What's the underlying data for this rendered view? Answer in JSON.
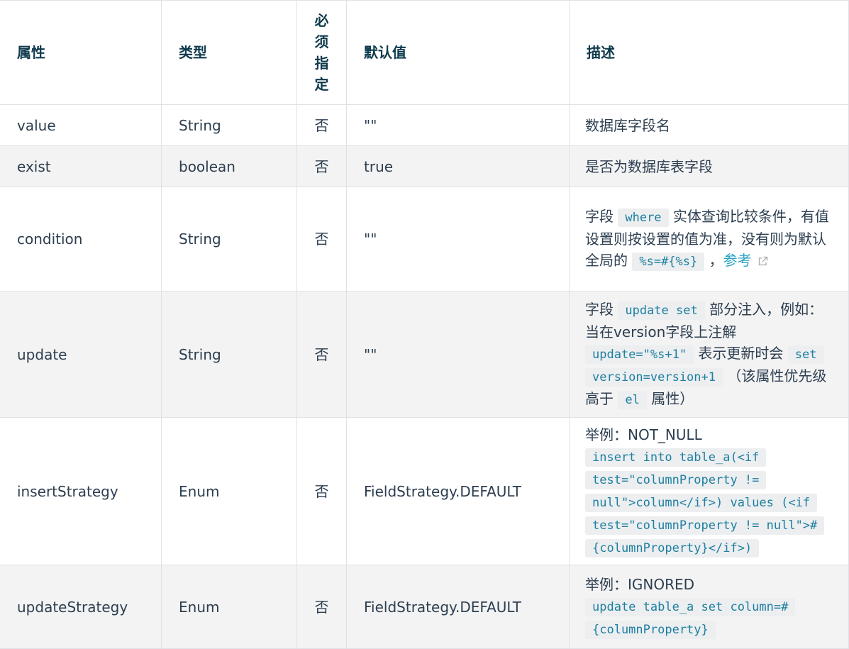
{
  "headers": {
    "attr": "属性",
    "type": "类型",
    "required": "必须指定",
    "default": "默认值",
    "desc": "描述"
  },
  "rows": [
    {
      "attr": "value",
      "type": "String",
      "required": "否",
      "default": "\"\"",
      "desc": "数据库字段名"
    },
    {
      "attr": "exist",
      "type": "boolean",
      "required": "否",
      "default": "true",
      "desc": "是否为数据库表字段"
    },
    {
      "attr": "condition",
      "type": "String",
      "required": "否",
      "default": "\"\"",
      "desc": {
        "t1": "字段 ",
        "c1": "where",
        "t2": " 实体查询比较条件，有值设置则按设置的值为准，没有则为默认全局的 ",
        "c2": "%s=#{%s}",
        "t3": " ，",
        "link": "参考"
      }
    },
    {
      "attr": "update",
      "type": "String",
      "required": "否",
      "default": "\"\"",
      "desc": {
        "t1": "字段 ",
        "c1": "update set",
        "t2": " 部分注入，例如：当在version字段上注解 ",
        "c2": "update=\"%s+1\"",
        "t3": " 表示更新时会 ",
        "c3": "set version=version+1",
        "t4": " （该属性优先级高于 ",
        "c4": "el",
        "t5": " 属性）"
      }
    },
    {
      "attr": "insertStrategy",
      "type": "Enum",
      "required": "否",
      "default": "FieldStrategy.DEFAULT",
      "desc": {
        "t1": "举例：NOT_NULL",
        "c1": "insert into table_a(<if test=\"columnProperty != null\">column</if>) values (<if test=\"columnProperty != null\">#{columnProperty}</if>)"
      }
    },
    {
      "attr": "updateStrategy",
      "type": "Enum",
      "required": "否",
      "default": "FieldStrategy.DEFAULT",
      "desc": {
        "t1": "举例：IGNORED",
        "c1": "update table_a set column=#{columnProperty}"
      }
    }
  ]
}
